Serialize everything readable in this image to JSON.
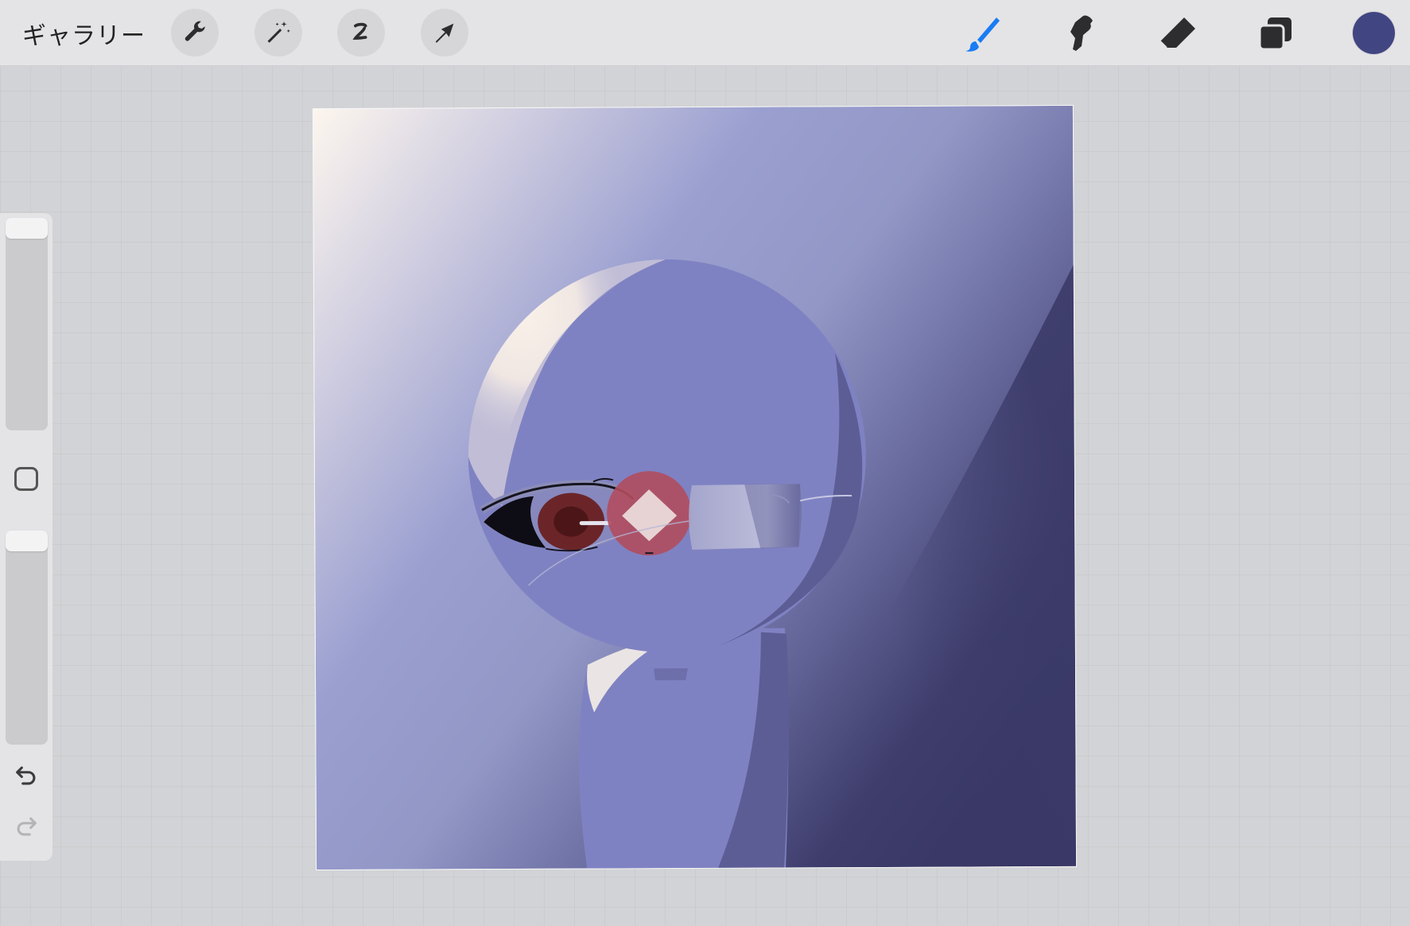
{
  "toolbar": {
    "gallery_label": "ギャラリー",
    "left_tools": [
      "wrench-icon",
      "magic-wand-icon",
      "selection-icon",
      "transform-arrow-icon"
    ],
    "right_tools": [
      "brush-icon",
      "smudge-icon",
      "eraser-icon",
      "layers-icon"
    ],
    "active_tool": "brush-icon",
    "accent_color": "#1a7cf4",
    "current_color": "#414582"
  },
  "sidebar": {
    "brush_size_level": 1.0,
    "opacity_level": 1.0,
    "icons": [
      "modify-square-icon",
      "undo-icon",
      "redo-icon"
    ]
  },
  "canvas": {
    "palette": {
      "background_light": "#fdf6ee",
      "background_mid": "#9097c6",
      "background_dark": "#3b3a68",
      "skin": "#7f82c2",
      "eye_red": "#6b2528",
      "lens_pink": "#b14d5e"
    }
  }
}
